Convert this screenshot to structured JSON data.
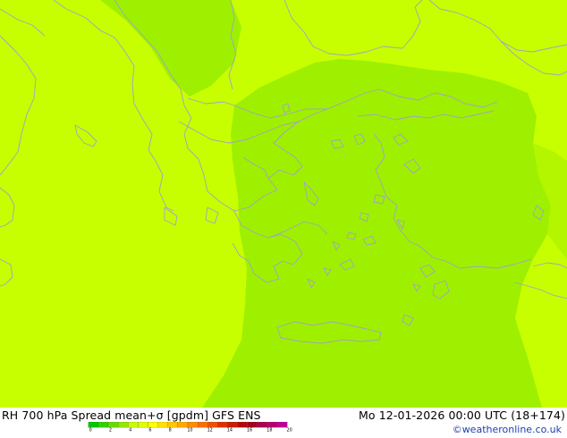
{
  "map": {
    "fill_colors": {
      "base": "#c8ff00",
      "spread_high": "#9ef000",
      "sea_edge": "#b4f500",
      "borders": "#a0a0c8"
    }
  },
  "title": {
    "left": "RH 700 hPa Spread mean+σ [gpdm] GFS ENS",
    "right": "Mo 12-01-2026 00:00 UTC (18+174)"
  },
  "legend": {
    "labels": [
      "0",
      "2",
      "4",
      "6",
      "8",
      "10",
      "12",
      "14",
      "16",
      "18",
      "20"
    ],
    "colors": [
      "#00c800",
      "#32d200",
      "#64dc00",
      "#96e600",
      "#c8ff00",
      "#e1ff00",
      "#ffff00",
      "#ffe100",
      "#ffc800",
      "#ffaa00",
      "#ff8c00",
      "#ff6e00",
      "#f05000",
      "#dc3200",
      "#c81e00",
      "#b40a00",
      "#a0001e",
      "#aa0050",
      "#b4006e",
      "#be0096"
    ]
  },
  "credit": "©weatheronline.co.uk"
}
